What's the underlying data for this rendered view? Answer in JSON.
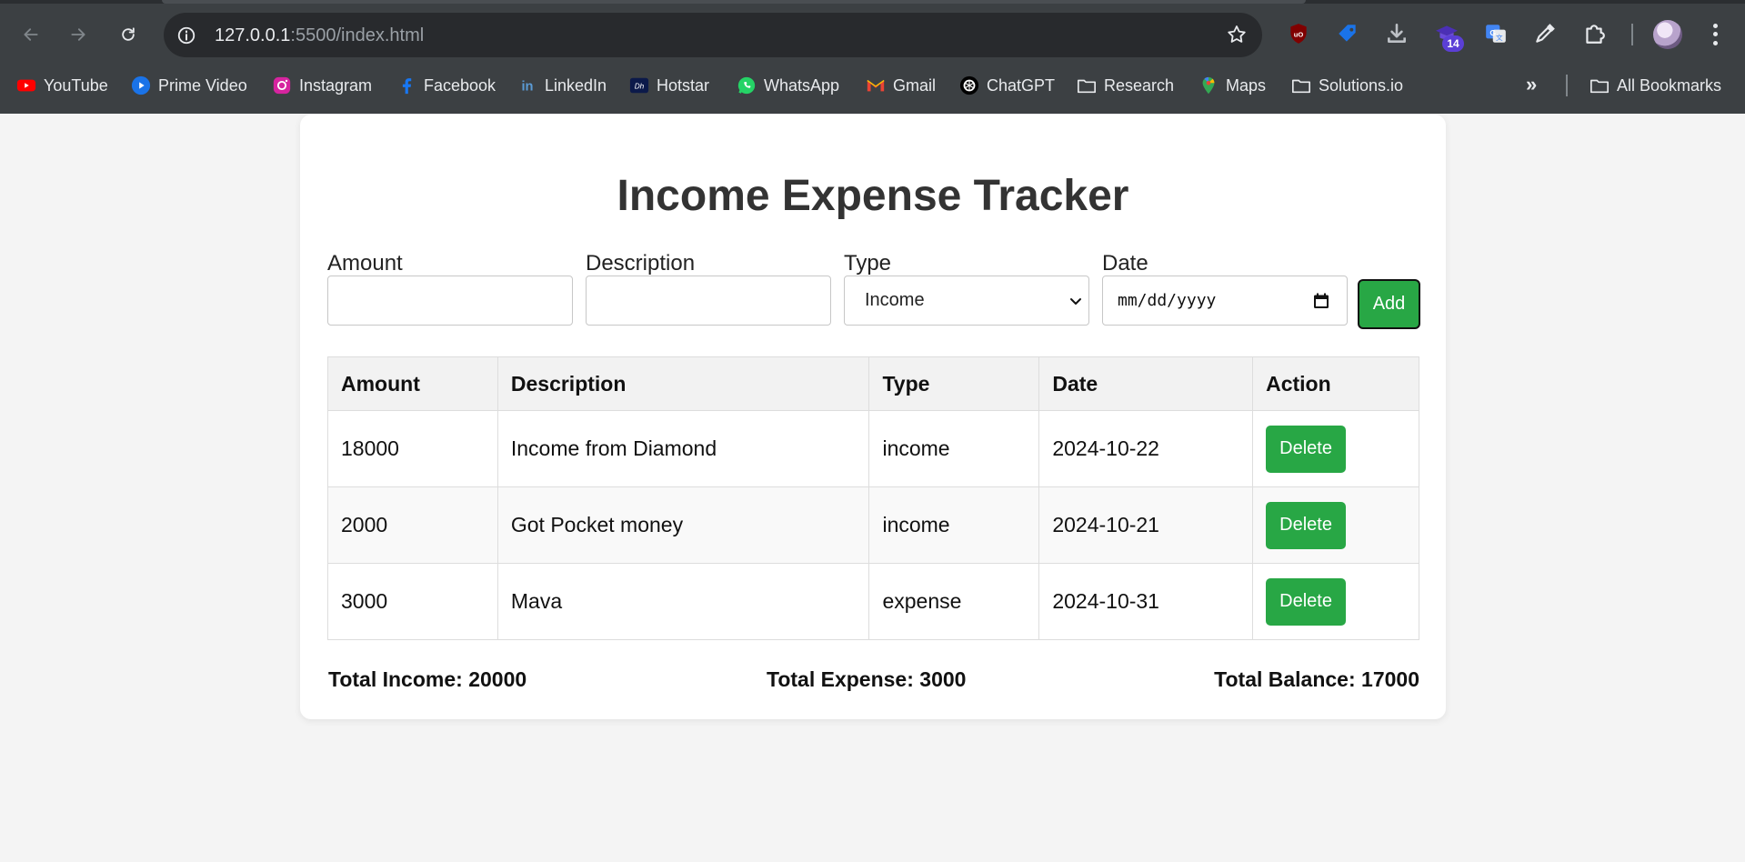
{
  "browser": {
    "url_host": "127.0.0.1",
    "url_rest": ":5500/index.html",
    "extension_badge": "14",
    "bookmarks": [
      {
        "label": "YouTube",
        "icon": "youtube-icon"
      },
      {
        "label": "Prime Video",
        "icon": "prime-video-icon"
      },
      {
        "label": "Instagram",
        "icon": "instagram-icon"
      },
      {
        "label": "Facebook",
        "icon": "facebook-icon"
      },
      {
        "label": "LinkedIn",
        "icon": "linkedin-icon"
      },
      {
        "label": "Hotstar",
        "icon": "hotstar-icon"
      },
      {
        "label": "WhatsApp",
        "icon": "whatsapp-icon"
      },
      {
        "label": "Gmail",
        "icon": "gmail-icon"
      },
      {
        "label": "ChatGPT",
        "icon": "chatgpt-icon"
      },
      {
        "label": "Research",
        "icon": "folder-icon"
      },
      {
        "label": "Maps",
        "icon": "maps-icon"
      },
      {
        "label": "Solutions.io",
        "icon": "folder-icon"
      }
    ],
    "all_bookmarks": "All Bookmarks",
    "more": "»"
  },
  "app": {
    "title": "Income Expense Tracker",
    "form": {
      "amount_label": "Amount",
      "amount_value": "",
      "description_label": "Description",
      "description_value": "",
      "type_label": "Type",
      "type_selected": "Income",
      "date_label": "Date",
      "date_placeholder": "mm/dd/yyyy",
      "add_label": "Add"
    },
    "table": {
      "headers": [
        "Amount",
        "Description",
        "Type",
        "Date",
        "Action"
      ],
      "rows": [
        {
          "amount": "18000",
          "description": "Income from Diamond",
          "type": "income",
          "date": "2024-10-22",
          "action": "Delete"
        },
        {
          "amount": "2000",
          "description": "Got Pocket money",
          "type": "income",
          "date": "2024-10-21",
          "action": "Delete"
        },
        {
          "amount": "3000",
          "description": "Mava",
          "type": "expense",
          "date": "2024-10-31",
          "action": "Delete"
        }
      ]
    },
    "totals": {
      "income": "Total Income: 20000",
      "expense": "Total Expense: 3000",
      "balance": "Total Balance: 17000"
    }
  },
  "colors": {
    "chrome_bg": "#3c4043",
    "omnibox_bg": "#282a2d",
    "page_bg": "#f4f4f4",
    "accent_green": "#28a745",
    "title_text": "#333333"
  }
}
